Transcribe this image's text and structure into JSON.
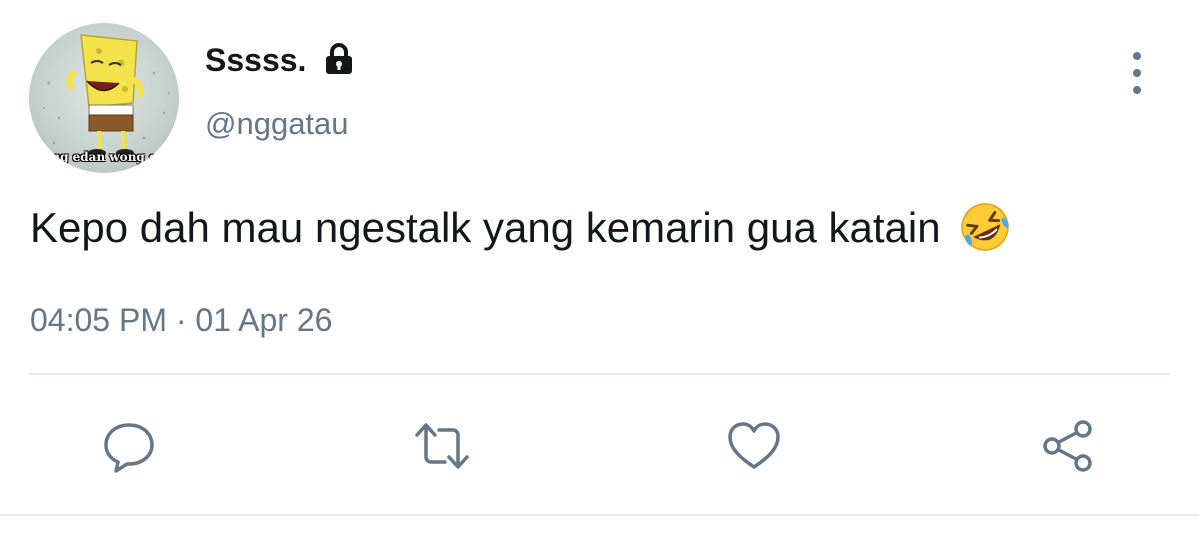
{
  "author": {
    "display_name": "Sssss.",
    "handle": "@nggatau",
    "avatar_caption": "ng edan wong e",
    "protected_icon": "lock-icon"
  },
  "tweet": {
    "text": "Kepo dah mau ngestalk yang kemarin gua katain",
    "emoji": "rolling-on-floor-laughing-icon",
    "time": "04:05 PM",
    "separator": "·",
    "date": "01 Apr 26"
  },
  "actions": {
    "reply": "reply-icon",
    "retweet": "retweet-icon",
    "like": "heart-icon",
    "share": "share-icon",
    "more": "more-options-icon"
  },
  "colors": {
    "text": "#14171a",
    "secondary": "#657786",
    "divider": "#e6ecf0"
  }
}
